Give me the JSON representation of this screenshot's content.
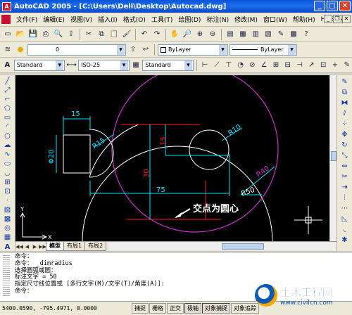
{
  "window": {
    "title": "AutoCAD 2005 - [C:\\Users\\Dell\\Desktop\\Autocad.dwg]",
    "min_glyph": "_",
    "max_glyph": "□",
    "close_glyph": "✕"
  },
  "menu": {
    "items": [
      "文件(F)",
      "编辑(E)",
      "视图(V)",
      "插入(I)",
      "格式(O)",
      "工具(T)",
      "绘图(D)",
      "标注(N)",
      "修改(M)",
      "窗口(W)",
      "帮助(H)",
      "HDSHM"
    ]
  },
  "properties_toolbar": {
    "layer_value": "0",
    "color_value": "ByLayer",
    "linetype_value": "ByLayer"
  },
  "styles_toolbar": {
    "text_style": "Standard",
    "dim_style": "ISO-25",
    "table_style": "Standard"
  },
  "drawing": {
    "dims": {
      "d15_top": "15",
      "d20": "Φ20",
      "r15": "R15",
      "d15_vert": "15",
      "d30": "30",
      "d75": "75",
      "r10": "R10",
      "r40": "R40",
      "r50": "R50"
    },
    "annotation": "交点为圆心",
    "axis_y": "Y",
    "axis_x": "X"
  },
  "layout_tabs": [
    "模型",
    "布局1",
    "布局2"
  ],
  "command_lines": [
    "命令：",
    "命令： _dimradius",
    "选择圆弧或圆：",
    "标注文字 = 50",
    "指定尺寸线位置或 [多行文字(M)/文字(T)/角度(A)]:",
    "命令："
  ],
  "status": {
    "coords": "5400.0590, -795.4971, 0.0000",
    "buttons": [
      "捕捉",
      "栅格",
      "正交",
      "极轴",
      "对象捕捉",
      "对象追踪"
    ]
  },
  "watermark": {
    "title": "土木工程网",
    "url": "www.civilcn.com"
  },
  "colors": {
    "cyan": "#00e5ff",
    "white": "#ffffff",
    "magenta": "#cc33cc",
    "red": "#ff2020"
  }
}
